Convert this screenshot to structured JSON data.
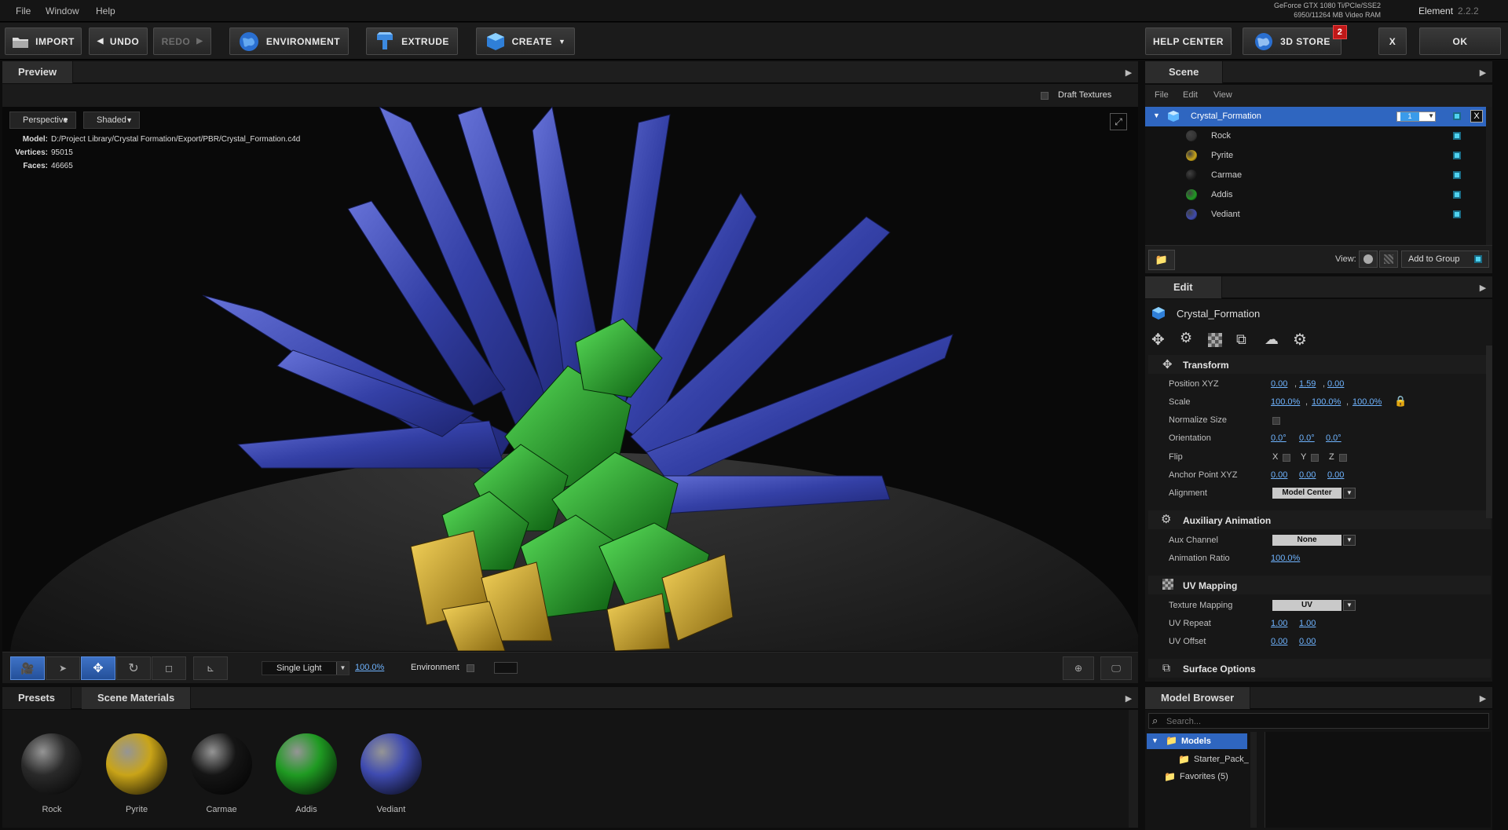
{
  "menu": [
    "File",
    "Window",
    "Help"
  ],
  "gpu": {
    "name": "GeForce GTX 1080 Ti/PCIe/SSE2",
    "vram": "6950/11264 MB Video RAM"
  },
  "app": {
    "name": "Element",
    "version": "2.2.2"
  },
  "toolbar": {
    "import": "IMPORT",
    "undo": "UNDO",
    "redo": "REDO",
    "environment": "ENVIRONMENT",
    "extrude": "EXTRUDE",
    "create": "CREATE",
    "help_center": "HELP CENTER",
    "store": "3D STORE",
    "store_badge": "2",
    "close": "X",
    "ok": "OK"
  },
  "preview": {
    "tab": "Preview",
    "draft_textures": "Draft Textures",
    "camera": "Perspective",
    "shading": "Shaded",
    "model_label": "Model:",
    "model_path": "D:/Project Library/Crystal Formation/Export/PBR/Crystal_Formation.c4d",
    "vertices_label": "Vertices:",
    "vertices": "95015",
    "faces_label": "Faces:",
    "faces": "46665"
  },
  "viewbar": {
    "light_mode": "Single Light",
    "light_intensity": "100.0%",
    "environment_label": "Environment"
  },
  "scene": {
    "tab": "Scene",
    "menu": [
      "File",
      "Edit",
      "View"
    ],
    "root": {
      "name": "Crystal_Formation",
      "group": "1"
    },
    "materials": [
      "Rock",
      "Pyrite",
      "Carmae",
      "Addis",
      "Vediant"
    ],
    "view_label": "View:",
    "add_to_group": "Add to Group"
  },
  "edit": {
    "tab": "Edit",
    "object_name": "Crystal_Formation",
    "transform": {
      "title": "Transform",
      "position_label": "Position XYZ",
      "position": [
        "0.00",
        "1.59",
        "0.00"
      ],
      "scale_label": "Scale",
      "scale": [
        "100.0%",
        "100.0%",
        "100.0%"
      ],
      "normalize_label": "Normalize Size",
      "orientation_label": "Orientation",
      "orientation": [
        "0.0°",
        "0.0°",
        "0.0°"
      ],
      "flip_label": "Flip",
      "flip_axes": [
        "X",
        "Y",
        "Z"
      ],
      "anchor_label": "Anchor Point XYZ",
      "anchor": [
        "0.00",
        "0.00",
        "0.00"
      ],
      "alignment_label": "Alignment",
      "alignment": "Model Center"
    },
    "aux": {
      "title": "Auxiliary Animation",
      "channel_label": "Aux Channel",
      "channel": "None",
      "ratio_label": "Animation Ratio",
      "ratio": "100.0%"
    },
    "uv": {
      "title": "UV Mapping",
      "mapping_label": "Texture Mapping",
      "mapping": "UV",
      "repeat_label": "UV Repeat",
      "repeat": [
        "1.00",
        "1.00"
      ],
      "offset_label": "UV Offset",
      "offset": [
        "0.00",
        "0.00"
      ]
    },
    "surface": {
      "title": "Surface Options"
    }
  },
  "bottom": {
    "tabs": [
      "Presets",
      "Scene Materials"
    ],
    "materials": [
      {
        "name": "Rock",
        "color": "#2a2a2a"
      },
      {
        "name": "Pyrite",
        "color": "#c9a418"
      },
      {
        "name": "Carmae",
        "color": "#151515"
      },
      {
        "name": "Addis",
        "color": "#1f9a22"
      },
      {
        "name": "Vediant",
        "color": "#3f4bb0"
      }
    ]
  },
  "model_browser": {
    "tab": "Model Browser",
    "search_placeholder": "Search...",
    "tree": {
      "root": "Models",
      "child": "Starter_Pack_",
      "favorites": "Favorites (5)"
    }
  },
  "colors": {
    "accent": "#2f66c0",
    "link": "#6fb4ff",
    "crystal_blue": "#3f4bb0",
    "crystal_green": "#1f9a22",
    "pyrite": "#c9a418"
  }
}
